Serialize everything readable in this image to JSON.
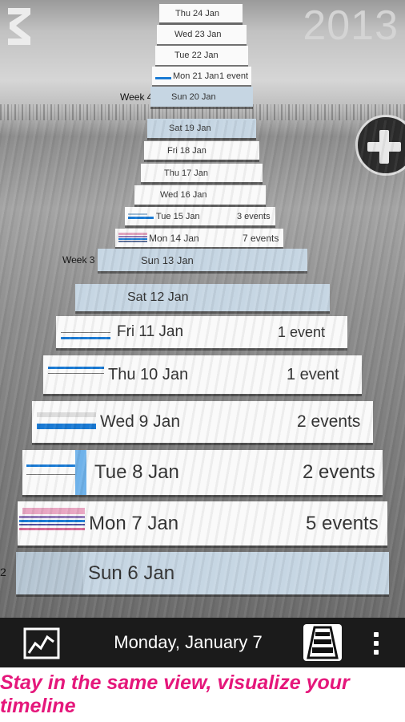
{
  "header": {
    "year": "2013"
  },
  "weeks": [
    {
      "label": "Week 4"
    },
    {
      "label": "Week 3"
    },
    {
      "label": "2"
    }
  ],
  "days": [
    {
      "date": "Thu 24 Jan",
      "events": ""
    },
    {
      "date": "Wed 23 Jan",
      "events": ""
    },
    {
      "date": "Tue 22 Jan",
      "events": ""
    },
    {
      "date": "Mon 21 Jan",
      "events": "1 event"
    },
    {
      "date": "Sun 20 Jan",
      "events": ""
    },
    {
      "date": "Sat 19 Jan",
      "events": ""
    },
    {
      "date": "Fri 18 Jan",
      "events": ""
    },
    {
      "date": "Thu 17 Jan",
      "events": ""
    },
    {
      "date": "Wed 16 Jan",
      "events": ""
    },
    {
      "date": "Tue 15 Jan",
      "events": "3 events"
    },
    {
      "date": "Mon 14 Jan",
      "events": "7 events"
    },
    {
      "date": "Sun 13 Jan",
      "events": ""
    },
    {
      "date": "Sat 12 Jan",
      "events": ""
    },
    {
      "date": "Fri 11 Jan",
      "events": "1 event"
    },
    {
      "date": "Thu 10 Jan",
      "events": "1 event"
    },
    {
      "date": "Wed 9 Jan",
      "events": "2 events"
    },
    {
      "date": "Tue 8 Jan",
      "events": "2 events"
    },
    {
      "date": "Mon 7 Jan",
      "events": "5 events"
    },
    {
      "date": "Sun 6 Jan",
      "events": ""
    }
  ],
  "bottom_bar": {
    "current_date": "Monday, January 7"
  },
  "caption": "Stay in the same view, visualize your timeline",
  "colors": {
    "event_blue": "#1a7ad4",
    "event_pink": "#e06a9c",
    "weekend": "#c6d6e3",
    "caption": "#e5177b"
  },
  "icons": {
    "logo": "z-logo-icon",
    "add": "plus-icon",
    "chart": "chart-icon",
    "view": "stairs-icon",
    "menu": "more-vert-icon"
  }
}
